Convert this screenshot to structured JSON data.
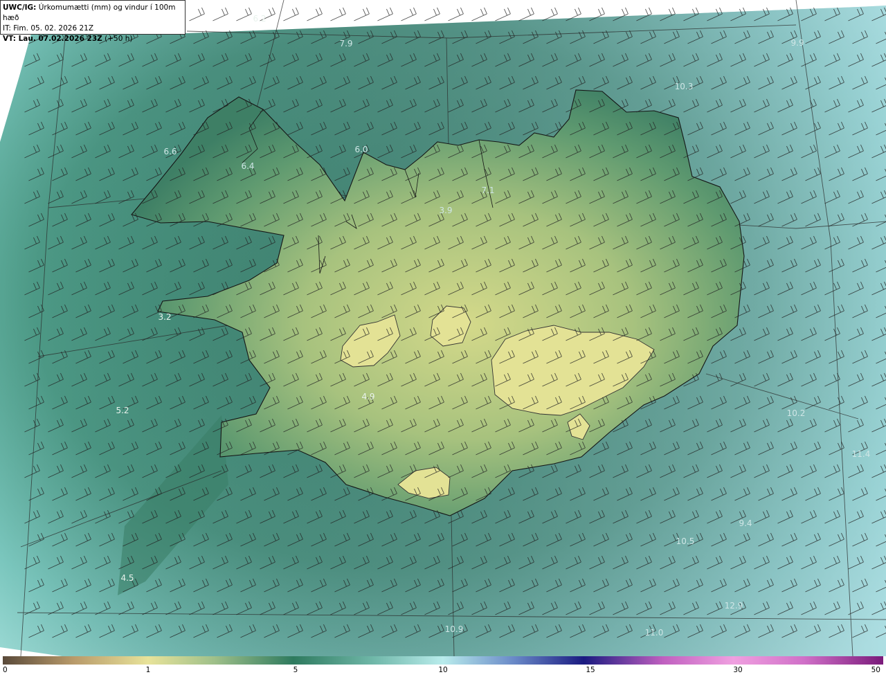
{
  "header": {
    "model_label": "UWC/IG:",
    "title_text": " Úrkomumætti (mm) og vindur í 100m hæð",
    "it_line": "IT: Fim. 05. 02. 2026 21Z",
    "vt_label": "VT: Lau. 07.02.2026 23Z",
    "vt_suffix": " (+50 h)"
  },
  "map_values": [
    {
      "text": "6.2"
    },
    {
      "text": "7.9"
    },
    {
      "text": "9.9"
    },
    {
      "text": "10.3"
    },
    {
      "text": "6.6"
    },
    {
      "text": "6.4"
    },
    {
      "text": "6.0"
    },
    {
      "text": "7.1"
    },
    {
      "text": "3.9"
    },
    {
      "text": "3.2"
    },
    {
      "text": "4.9"
    },
    {
      "text": "5.2"
    },
    {
      "text": "4.5"
    },
    {
      "text": "10.2"
    },
    {
      "text": "11.4"
    },
    {
      "text": "10.5"
    },
    {
      "text": "9.4"
    },
    {
      "text": "12.9"
    },
    {
      "text": "10.9"
    },
    {
      "text": "11.0"
    }
  ],
  "colorbar": {
    "ticks": [
      "0",
      "1",
      "5",
      "10",
      "15",
      "30",
      "50"
    ],
    "colors": {
      "zero": "#5a4a3a",
      "low": "#e8e39a",
      "mid": "#2e7a5e",
      "ten": "#b9ecec",
      "fifteen": "#1a1a80",
      "thirty": "#f0a0e0",
      "fifty": "#7a1a7a"
    }
  },
  "palette": {
    "land_high": "#d9d98a",
    "land_mid": "#5a9a6c",
    "sea": "#3e8f7c",
    "sea_far": "#8fd6d0",
    "coast": "#1a1a1a"
  }
}
